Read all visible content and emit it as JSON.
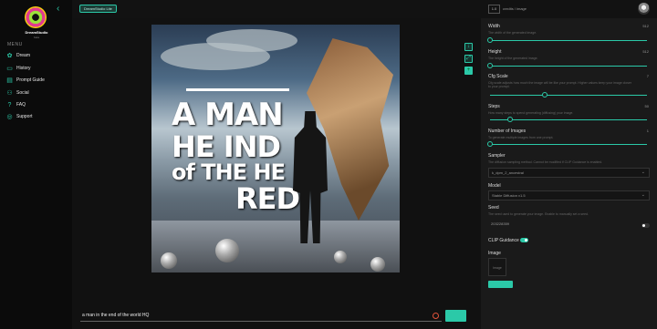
{
  "app": {
    "name": "DreamStudio",
    "subtitle": "beta"
  },
  "sidebar": {
    "menu_label": "MENU",
    "items": [
      {
        "label": "Dream",
        "icon": "dream-icon"
      },
      {
        "label": "History",
        "icon": "history-icon"
      },
      {
        "label": "Prompt Guide",
        "icon": "book-icon"
      },
      {
        "label": "Social",
        "icon": "people-icon"
      },
      {
        "label": "FAQ",
        "icon": "help-icon"
      },
      {
        "label": "Support",
        "icon": "support-icon"
      }
    ]
  },
  "topbar": {
    "app_pill": "DreamStudio Lite",
    "credits_value": "1.0",
    "credits_label": "credits / image"
  },
  "artwork": {
    "line1": "A MAN",
    "line2": "HE IND",
    "line3": "of THE HE",
    "line4": "RED"
  },
  "prompt": {
    "value": "a man in the end of the world HQ"
  },
  "settings": {
    "width": {
      "label": "Width",
      "desc": "The width of the generated image.",
      "value": "512",
      "level": 0.0
    },
    "height": {
      "label": "Height",
      "desc": "The height of the generated image.",
      "value": "512",
      "level": 0.0
    },
    "cfg": {
      "label": "Cfg Scale",
      "desc": "Cfg scale adjusts how much the image will be like your prompt. Higher values keep your image closer to your prompt.",
      "value": "7",
      "level": 0.35
    },
    "steps": {
      "label": "Steps",
      "desc": "How many steps to spend generating (diffusing) your image.",
      "value": "50",
      "level": 0.13
    },
    "num_images": {
      "label": "Number of Images",
      "desc": "To generate multiple images from one prompt.",
      "value": "1",
      "level": 0.0
    },
    "sampler": {
      "label": "Sampler",
      "desc": "The diffusion sampling method. Cannot be modified if CLIP Guidance is enabled.",
      "value": "k_dpm_2_ancestral"
    },
    "model": {
      "label": "Model",
      "value": "Stable Diffusion v1.5"
    },
    "seed": {
      "label": "Seed",
      "desc": "The seed used to generate your image. Enable to manually set a seed.",
      "value": "203228359"
    },
    "clip": {
      "label": "CLIP Guidance",
      "on": true
    },
    "image": {
      "label": "Image",
      "drop_text": "Image"
    }
  },
  "colors": {
    "accent": "#2bc9a8",
    "background": "#121212",
    "panel": "#1a1a1a"
  }
}
